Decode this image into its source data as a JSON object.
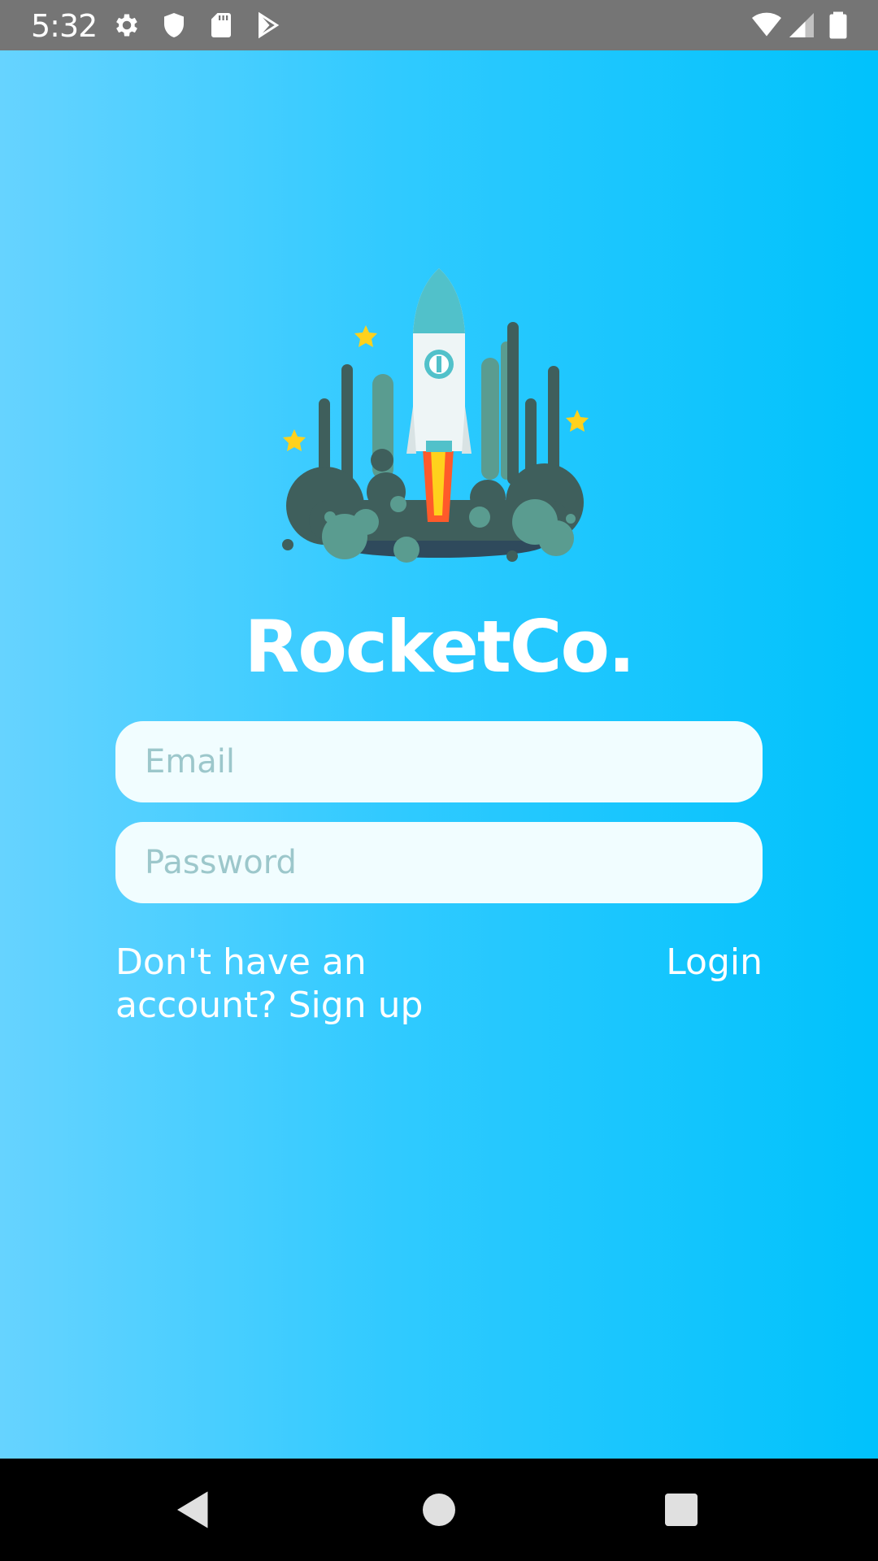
{
  "status_bar": {
    "time": "5:32",
    "icons_left": [
      "gear-icon",
      "shield-icon",
      "sd-card-icon",
      "play-store-icon"
    ],
    "icons_right": [
      "wifi-icon",
      "cell-signal-icon",
      "battery-icon"
    ]
  },
  "app": {
    "logo_alt": "rocket launch illustration",
    "title": "RocketCo.",
    "email": {
      "placeholder": "Email",
      "value": ""
    },
    "password": {
      "placeholder": "Password",
      "value": ""
    },
    "signup_text": "Don't have an account? Sign up",
    "login_label": "Login",
    "colors": {
      "gradient_left": "#66d3ff",
      "gradient_right": "#00c2fc",
      "input_bg": "#f1fdff",
      "placeholder": "#9cc7cb"
    }
  },
  "nav_bar": {
    "buttons": [
      "back-icon",
      "home-icon",
      "recents-icon"
    ]
  }
}
